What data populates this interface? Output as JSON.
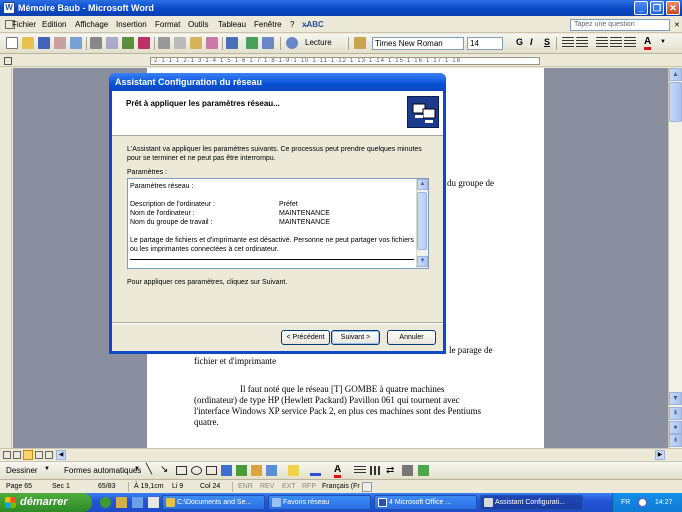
{
  "window": {
    "title": "Mémoire Baub - Microsoft Word",
    "app_icon": "W"
  },
  "menu": {
    "items": [
      "Fichier",
      "Edition",
      "Affichage",
      "Insertion",
      "Format",
      "Outils",
      "Tableau",
      "Fenêtre",
      "?"
    ],
    "help_placeholder": "Tapez une question"
  },
  "toolbar": {
    "font": "Times New Roman",
    "size": "14",
    "bold": "G",
    "italic": "I",
    "underline": "S",
    "reading": "Lecture"
  },
  "ruler": {
    "marks": "·2·1·1·1·2·1·3·1·4·1·5·1·6·1·7·1·8·1·9·1·10·1·11·1·12·1·13·1·14·1·15·1·16·1·17·1·18·"
  },
  "document": {
    "frag1": "du groupe de",
    "frag2": "le parage de",
    "frag3": "fichier et d'imprimante",
    "para_l1": "Il faut noté que le réseau [T] GOMBE à quatre machines",
    "para_l2": "(ordinateur) de type HP (Hewlett Packard) Pavillon 061 qui tournent avec",
    "para_l3": "l'interface Windows XP service Pack 2, en plus ces machines sont des Pentiums",
    "para_l4": "quatre."
  },
  "dialog": {
    "title": "Assistant Configuration du réseau",
    "heading": "Prêt à appliquer les paramètres réseau...",
    "intro": "L'Assistant va appliquer les paramètres suivants. Ce processus peut prendre quelques minutes pour se terminer et ne peut pas être interrompu.",
    "params_label": "Paramètres :",
    "list": {
      "header": "Paramètres réseau :",
      "rows": [
        {
          "label": "Description de l'ordinateur :",
          "value": "Préfet"
        },
        {
          "label": "Nom de l'ordinateur :",
          "value": "MAINTENANCE"
        },
        {
          "label": "Nom du groupe de travail :",
          "value": "MAINTENANCE"
        }
      ],
      "note": "Le partage de fichiers et d'imprimante est désactivé. Personne ne peut partager vos fichiers ou les imprimantes connectées à cet ordinateur."
    },
    "apply_hint": "Pour appliquer ces paramètres, cliquez sur Suivant.",
    "buttons": {
      "back": "< Précédent",
      "next": "Suivant >",
      "cancel": "Annuler"
    }
  },
  "drawing": {
    "draw": "Dessiner",
    "autoshapes": "Formes automatiques"
  },
  "status": {
    "page": "Page 65",
    "section": "Sec 1",
    "pages": "65/83",
    "pos": "À 19,1cm",
    "line": "Li 9",
    "col": "Col 24",
    "rec": "ENR",
    "rev": "REV",
    "ext": "EXT",
    "ovr": "RFP",
    "lang": "Français (Fr"
  },
  "taskbar": {
    "start": "démarrer",
    "tasks": [
      "C:\\Documents and Se...",
      "Favoris réseau",
      "4 Microsoft Office ...",
      "Assistant Configurati..."
    ],
    "lang": "FR",
    "time": "14:27"
  },
  "colors": {
    "accent": "#0a52d6",
    "taskbar": "#2456d8",
    "start": "#2f8a25"
  }
}
